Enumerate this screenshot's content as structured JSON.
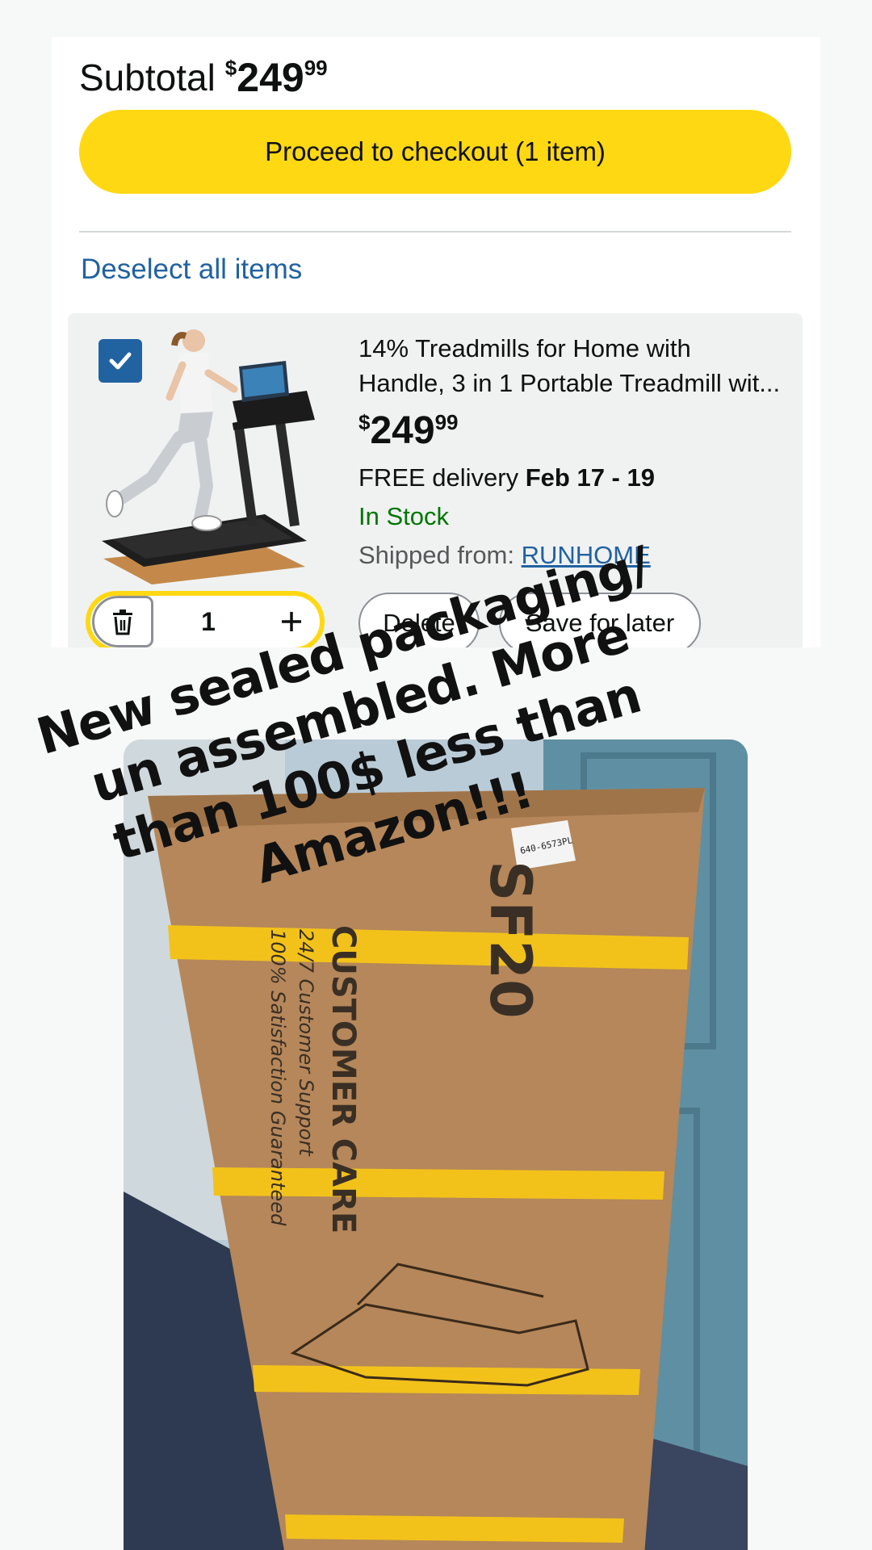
{
  "cart": {
    "subtotal_label": "Subtotal",
    "subtotal_currency": "$",
    "subtotal_whole": "249",
    "subtotal_fraction": "99",
    "checkout_label": "Proceed to checkout (1 item)",
    "deselect_label": "Deselect all items"
  },
  "item": {
    "selected": true,
    "title_line1": "14% Treadmills for Home with",
    "title_line2": "Handle, 3 in 1 Portable Treadmill wit...",
    "price_currency": "$",
    "price_whole": "249",
    "price_fraction": "99",
    "delivery_prefix": "FREE delivery",
    "delivery_dates": "Feb 17 - 19",
    "stock_status": "In Stock",
    "shipped_from_label": "Shipped from:",
    "shipped_from_seller": "RUNHOME",
    "quantity": "1",
    "delete_label": "Delete",
    "save_label": "Save for later",
    "image_icon": "treadmill-product-image"
  },
  "overlay": {
    "lines": [
      "New sealed packaging/",
      "un assembled. More",
      "than 100$ less than",
      "Amazon!!!"
    ]
  },
  "photo": {
    "box_text_1": "SF20",
    "box_text_2": "CUSTOMER CARE",
    "box_text_3": "24/7 Customer Support",
    "box_text_4": "100% Satisfaction Guaranteed",
    "label_text": "640-6573PL"
  },
  "colors": {
    "checkout_yellow": "#ffd814",
    "link_blue": "#2162a1",
    "in_stock_green": "#007600"
  }
}
